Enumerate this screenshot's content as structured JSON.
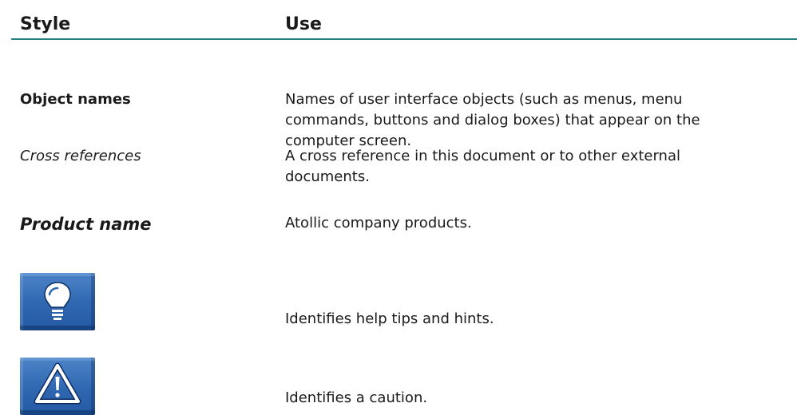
{
  "header": {
    "style_label": "Style",
    "use_label": "Use"
  },
  "rows": [
    {
      "style": "Object names",
      "use_lines": [
        "Names of user interface objects (such as menus, menu",
        "commands, buttons and dialog boxes) that appear on the",
        "computer screen."
      ]
    },
    {
      "style": "Cross references",
      "use_lines": [
        "A cross reference in this document or to other external",
        "documents."
      ]
    },
    {
      "style": "Product name",
      "use_lines": [
        "Atollic company products."
      ]
    }
  ],
  "icons": [
    {
      "icon": "lightbulb-icon",
      "use": "Identifies help tips and hints."
    },
    {
      "icon": "warning-triangle-icon",
      "use": "Identifies a caution."
    }
  ],
  "colors": {
    "rule": "#2e7f86",
    "icon_background": "#2f67b0",
    "icon_glyph": "#ffffff"
  }
}
